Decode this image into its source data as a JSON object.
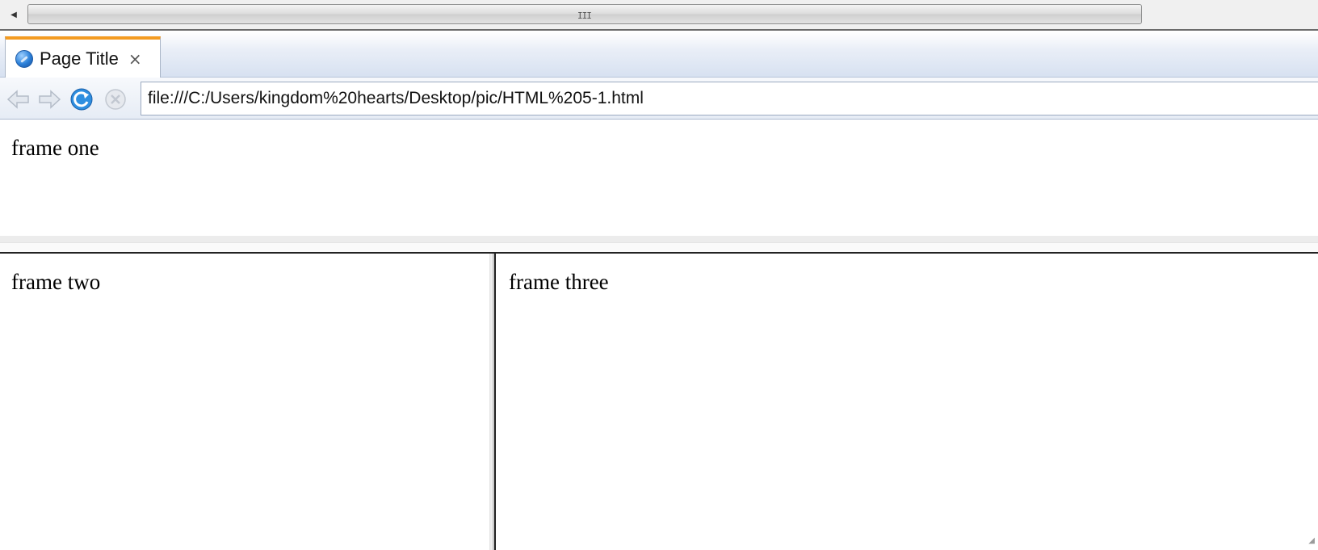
{
  "tab": {
    "title": "Page Title",
    "close_glyph": "×",
    "favicon_icon": "globe-icon"
  },
  "navbar": {
    "back_icon": "back-arrow-icon",
    "forward_icon": "forward-arrow-icon",
    "reload_icon": "reload-icon",
    "stop_icon": "stop-icon",
    "url": "file:///C:/Users/kingdom%20hearts/Desktop/pic/HTML%205-1.html"
  },
  "scrollbar": {
    "left_arrow": "◀",
    "grip": "III"
  },
  "frames": {
    "one": "frame one",
    "two": "frame two",
    "three": "frame three"
  },
  "colors": {
    "tab_accent": "#f39b21",
    "frame_border": "#222222"
  }
}
